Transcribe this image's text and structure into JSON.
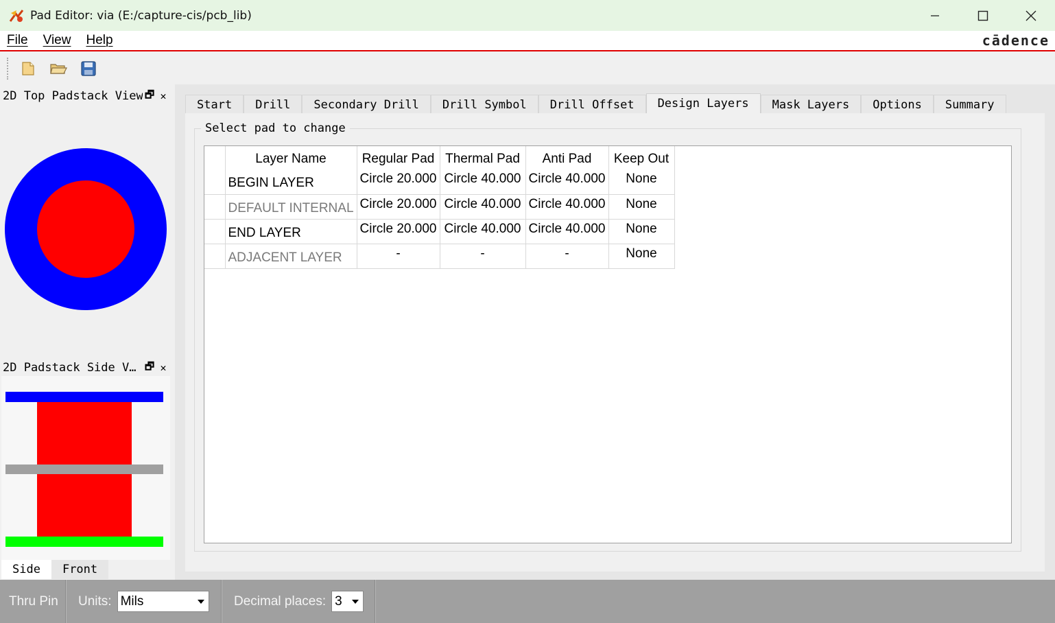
{
  "window": {
    "title": "Pad Editor: via  (E:/capture-cis/pcb_lib)",
    "controls": {
      "minimize": "—",
      "maximize": "☐",
      "close": "✕"
    }
  },
  "menu": {
    "items": [
      "File",
      "View",
      "Help"
    ],
    "brand": "cādence"
  },
  "toolbar": {
    "icons": [
      "new-file-icon",
      "open-folder-icon",
      "save-disk-icon"
    ]
  },
  "panels": {
    "top_view": {
      "title": "2D Top Padstack View",
      "float": "🗗",
      "close": "✕"
    },
    "side_view": {
      "title": "2D Padstack Side V…",
      "float": "🗗",
      "close": "✕"
    },
    "side_tabs": [
      "Side",
      "Front"
    ],
    "colors": {
      "regular_pad": "#ff0000",
      "anti_pad": "#0000ff",
      "internal": "#a0a0a0",
      "end_layer": "#00ff00"
    }
  },
  "tabs": [
    "Start",
    "Drill",
    "Secondary Drill",
    "Drill Symbol",
    "Drill Offset",
    "Design Layers",
    "Mask Layers",
    "Options",
    "Summary"
  ],
  "active_tab": "Design Layers",
  "group": {
    "title": "Select pad to change"
  },
  "table": {
    "headers": [
      "Layer Name",
      "Regular Pad",
      "Thermal Pad",
      "Anti Pad",
      "Keep Out"
    ],
    "rows": [
      {
        "name": "BEGIN LAYER",
        "regular": "Circle 20.000",
        "thermal": "Circle 40.000",
        "anti": "Circle 40.000",
        "keepout": "None",
        "muted": false
      },
      {
        "name": "DEFAULT INTERNAL",
        "regular": "Circle 20.000",
        "thermal": "Circle 40.000",
        "anti": "Circle 40.000",
        "keepout": "None",
        "muted": true
      },
      {
        "name": "END LAYER",
        "regular": "Circle 20.000",
        "thermal": "Circle 40.000",
        "anti": "Circle 40.000",
        "keepout": "None",
        "muted": false
      },
      {
        "name": "ADJACENT LAYER",
        "regular": "-",
        "thermal": "-",
        "anti": "-",
        "keepout": "None",
        "muted": true
      }
    ]
  },
  "status": {
    "mode": "Thru Pin",
    "units_label": "Units:",
    "units_value": "Mils",
    "decimal_label": "Decimal places:",
    "decimal_value": "3"
  }
}
